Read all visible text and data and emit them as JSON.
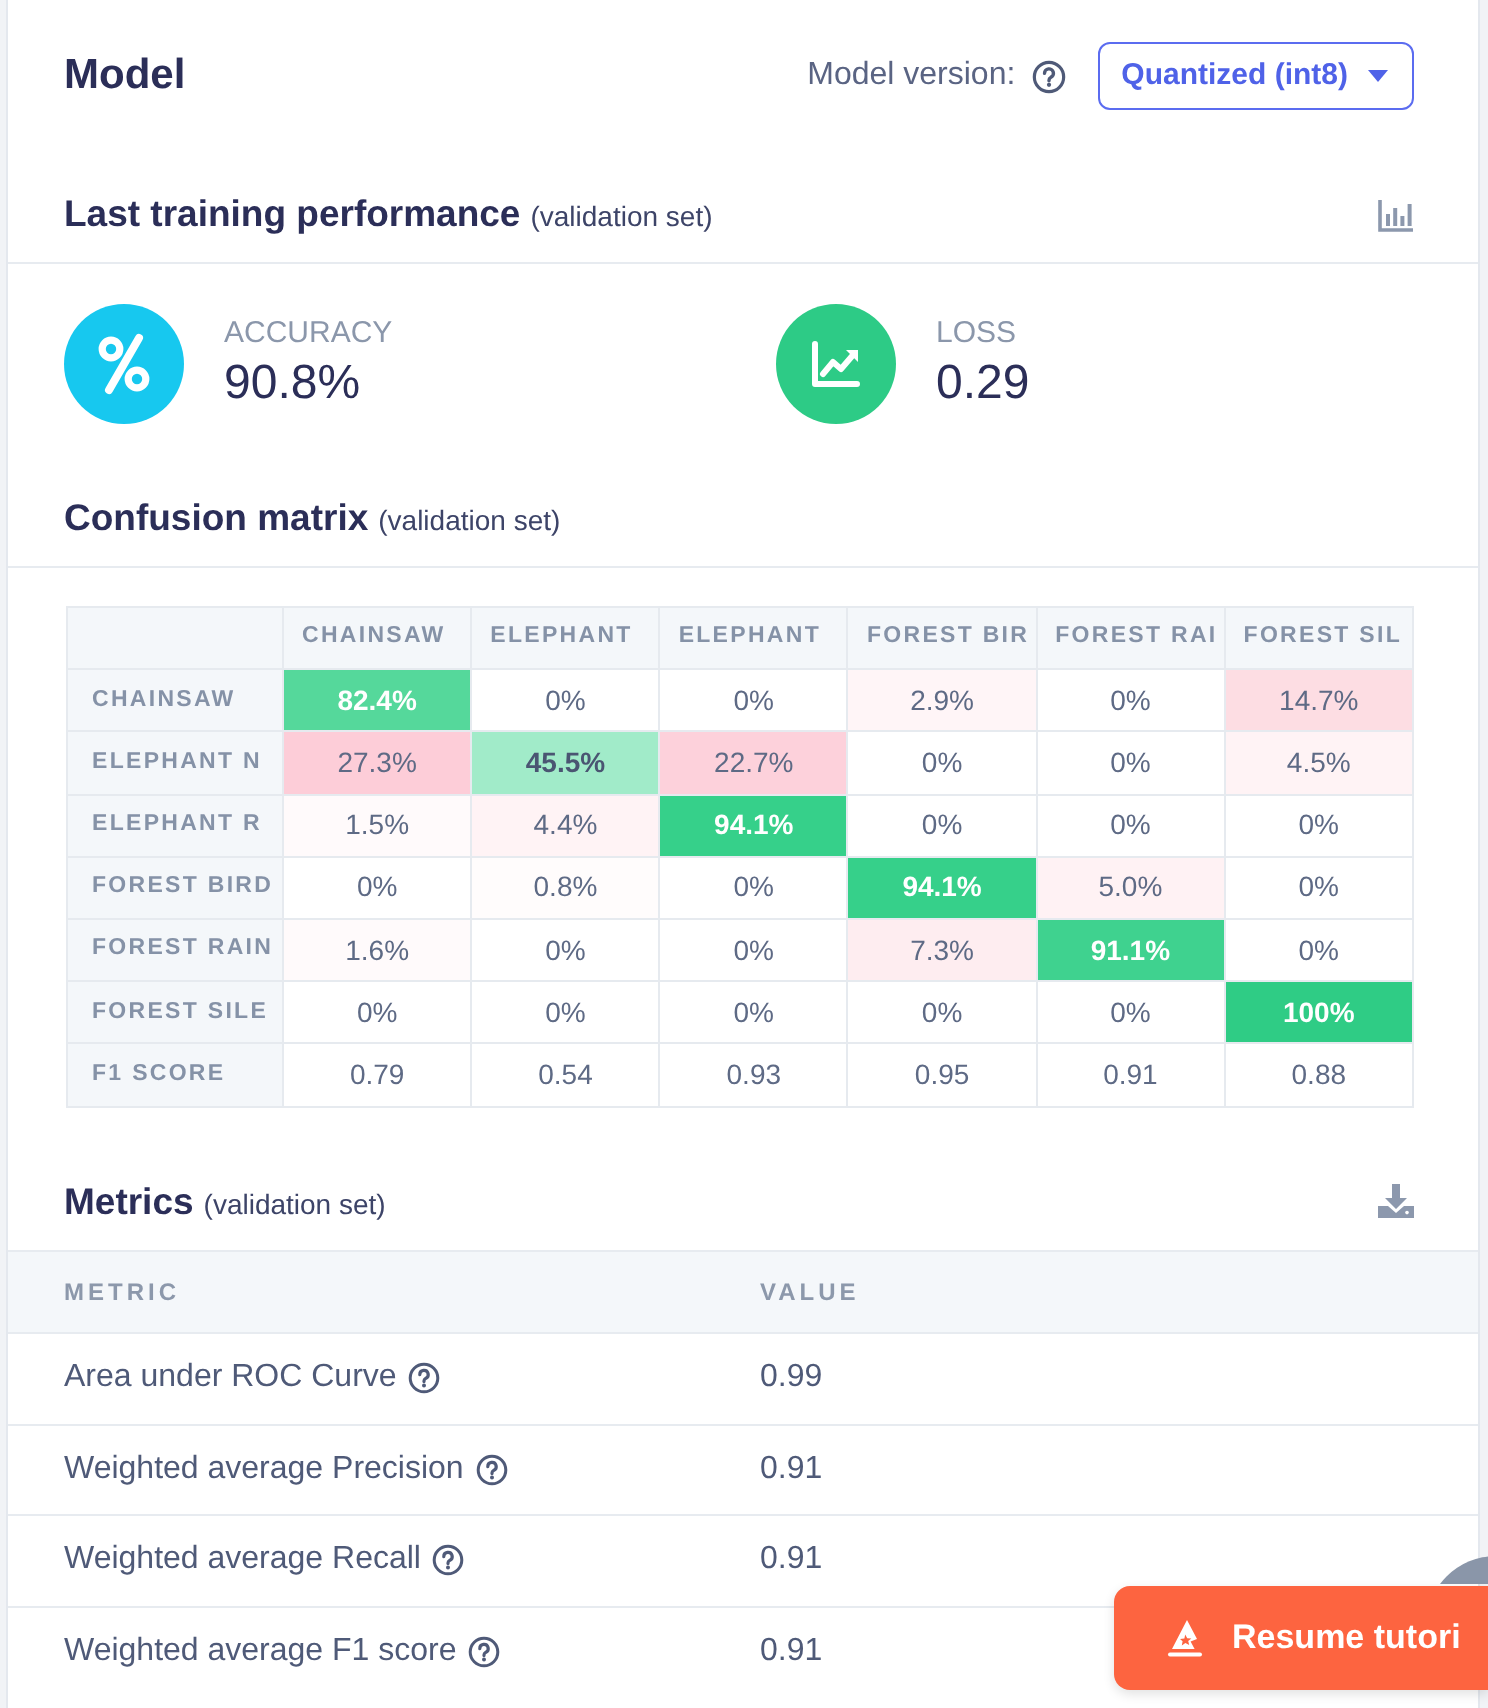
{
  "header": {
    "title": "Model",
    "version_label": "Model version:",
    "version_select": "Quantized (int8)"
  },
  "performance": {
    "title": "Last training performance",
    "subtitle": "(validation set)",
    "stats": [
      {
        "kind": "accuracy",
        "label": "ACCURACY",
        "value": "90.8%",
        "color": "#17c8ef"
      },
      {
        "kind": "loss",
        "label": "LOSS",
        "value": "0.29",
        "color": "#2dcb86"
      }
    ]
  },
  "confusion_matrix": {
    "title": "Confusion matrix",
    "subtitle": "(validation set)",
    "columns": [
      "CHAINSAW",
      "ELEPHANT",
      "ELEPHANT",
      "FOREST BIR",
      "FOREST RAI",
      "FOREST SIL"
    ],
    "rows": [
      {
        "label": "CHAINSAW",
        "cells": [
          {
            "value": "82.4%",
            "color": "#55d89b"
          },
          {
            "value": "0%"
          },
          {
            "value": "0%"
          },
          {
            "value": "2.9%",
            "color": "#fff5f7"
          },
          {
            "value": "0%"
          },
          {
            "value": "14.7%",
            "color": "#fddde3"
          }
        ]
      },
      {
        "label": "ELEPHANT N",
        "cells": [
          {
            "value": "27.3%",
            "color": "#fdcdd8"
          },
          {
            "value": "45.5%",
            "color": "#a1ebc9"
          },
          {
            "value": "22.7%",
            "color": "#fdd1db"
          },
          {
            "value": "0%"
          },
          {
            "value": "0%"
          },
          {
            "value": "4.5%",
            "color": "#fff3f5"
          }
        ]
      },
      {
        "label": "ELEPHANT R",
        "cells": [
          {
            "value": "1.5%",
            "color": "#fffafb"
          },
          {
            "value": "4.4%",
            "color": "#fff3f5"
          },
          {
            "value": "94.1%",
            "color": "#36d08a"
          },
          {
            "value": "0%"
          },
          {
            "value": "0%"
          },
          {
            "value": "0%"
          }
        ]
      },
      {
        "label": "FOREST BIRD",
        "cells": [
          {
            "value": "0%"
          },
          {
            "value": "0.8%",
            "color": "#fffcfc"
          },
          {
            "value": "0%"
          },
          {
            "value": "94.1%",
            "color": "#36d08a"
          },
          {
            "value": "5.0%",
            "color": "#fff2f4"
          },
          {
            "value": "0%"
          }
        ]
      },
      {
        "label": "FOREST RAIN",
        "cells": [
          {
            "value": "1.6%",
            "color": "#fffafb"
          },
          {
            "value": "0%"
          },
          {
            "value": "0%"
          },
          {
            "value": "7.3%",
            "color": "#feedf0"
          },
          {
            "value": "91.1%",
            "color": "#3fd28f"
          },
          {
            "value": "0%"
          }
        ]
      },
      {
        "label": "FOREST SILE",
        "cells": [
          {
            "value": "0%"
          },
          {
            "value": "0%"
          },
          {
            "value": "0%"
          },
          {
            "value": "0%"
          },
          {
            "value": "0%"
          },
          {
            "value": "100%",
            "color": "#2fcc85"
          }
        ]
      },
      {
        "label": "F1 SCORE",
        "cells": [
          {
            "value": "0.79"
          },
          {
            "value": "0.54"
          },
          {
            "value": "0.93"
          },
          {
            "value": "0.95"
          },
          {
            "value": "0.91"
          },
          {
            "value": "0.88"
          }
        ]
      }
    ]
  },
  "metrics": {
    "title": "Metrics",
    "subtitle": "(validation set)",
    "columns": [
      "METRIC",
      "VALUE"
    ],
    "rows": [
      {
        "name": "Area under ROC Curve",
        "value": "0.99"
      },
      {
        "name": "Weighted average Precision",
        "value": "0.91"
      },
      {
        "name": "Weighted average Recall",
        "value": "0.91"
      },
      {
        "name": "Weighted average F1 score",
        "value": "0.91"
      }
    ]
  },
  "tutorial_button": {
    "label": "Resume tutori"
  }
}
